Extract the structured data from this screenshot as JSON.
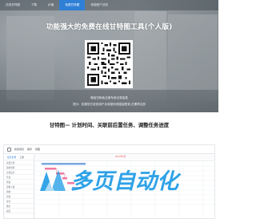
{
  "nav": {
    "tabs": [
      {
        "label": "在线甘特图"
      },
      {
        "label": "下载"
      },
      {
        "label": "价格"
      },
      {
        "label": "免费甘特图"
      },
      {
        "label": "体验账户试用"
      }
    ],
    "active_index": 3
  },
  "hero": {
    "title": "功能强大的免费在线甘特图工具(个人版)",
    "qr_caption": "微信扫码免注册专用记录信息",
    "qr_tip": "提示：如果您已收到用户名和密码请直接登录,无需再注册"
  },
  "section": {
    "subtitle": "甘特图— 计划时间、关联前后置任务、调整任务进度"
  },
  "preview": {
    "toolbar": [
      {
        "label": "新建项目"
      },
      {
        "label": "保存"
      },
      {
        "label": "视图"
      }
    ],
    "left_tabs": [
      {
        "label": "任务名称"
      },
      {
        "label": "工期"
      }
    ],
    "tasks": [
      {
        "label": "项目计划"
      },
      {
        "label": "需求调研"
      },
      {
        "label": "方案设计"
      },
      {
        "label": "开发"
      },
      {
        "label": "测试"
      },
      {
        "label": "部署上线"
      },
      {
        "label": "验收"
      },
      {
        "label": "培训"
      },
      {
        "label": "交付"
      },
      {
        "label": "维护"
      },
      {
        "label": "总结"
      }
    ],
    "grid_header": "2017年1月"
  },
  "watermark": {
    "text": "多页自动化"
  },
  "colors": {
    "accent": "#2f7fd6",
    "watermark": "#1e9be6",
    "gantt_bar": "#f07aa0",
    "gantt_bar_blue": "#7aa7e0"
  }
}
